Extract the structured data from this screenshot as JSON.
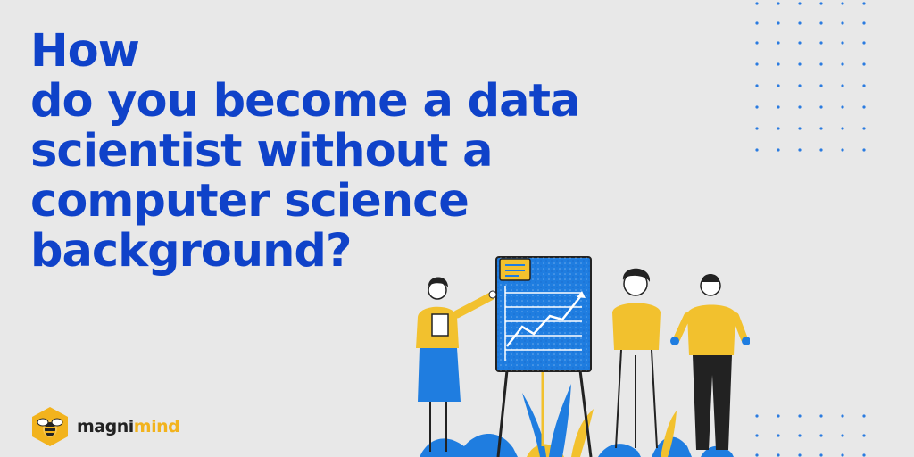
{
  "headline": {
    "lines": [
      "How",
      "do you become a data",
      "scientist without a",
      "computer science",
      "background?"
    ]
  },
  "brand": {
    "name_part1": "magni",
    "name_part2": "mind",
    "icon": "bee-hexagon-icon"
  },
  "colors": {
    "background": "#e8e8e8",
    "headline": "#0f42c9",
    "accent_yellow": "#f2c12e",
    "accent_blue": "#1f7de0"
  }
}
